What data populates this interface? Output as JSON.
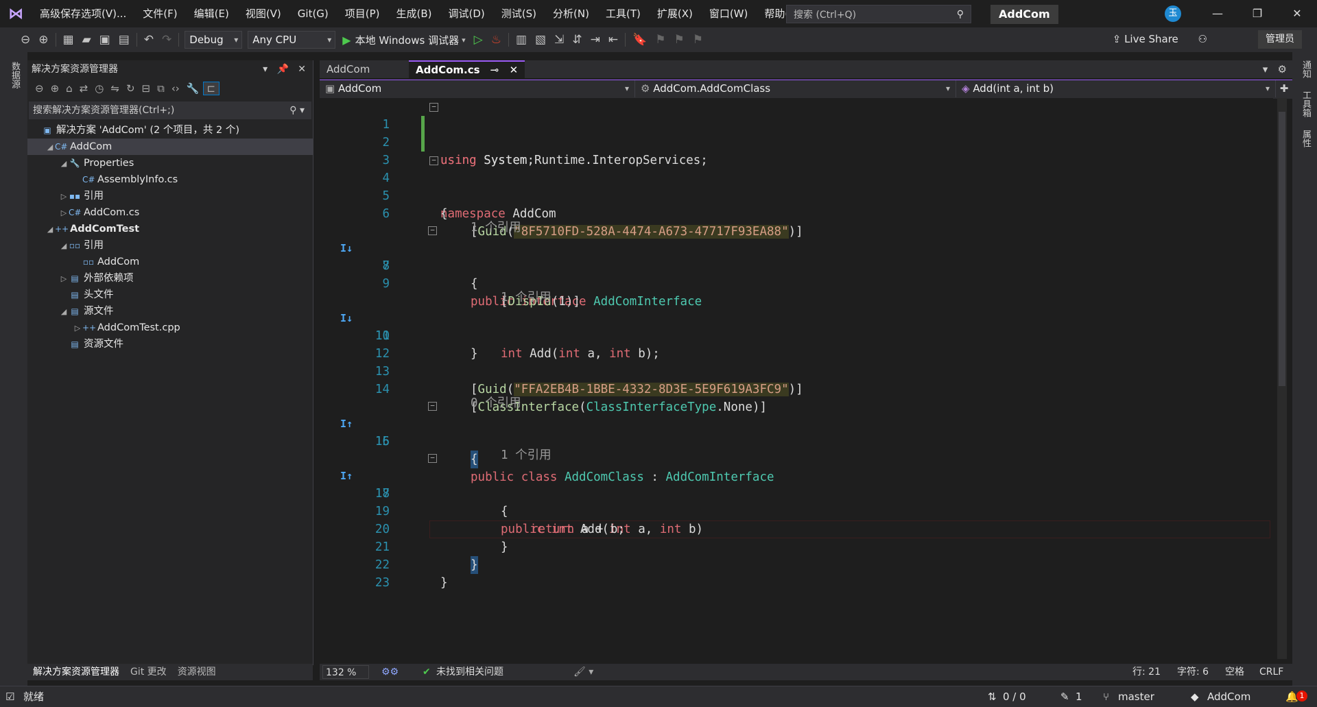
{
  "menu": [
    "高级保存选项(V)...",
    "文件(F)",
    "编辑(E)",
    "视图(V)",
    "Git(G)",
    "项目(P)",
    "生成(B)",
    "调试(D)",
    "测试(S)",
    "分析(N)",
    "工具(T)",
    "扩展(X)",
    "窗口(W)",
    "帮助(H)"
  ],
  "search": {
    "placeholder": "搜索 (Ctrl+Q)"
  },
  "title": "AddCom",
  "avatar": "玉",
  "toolbar": {
    "config": "Debug",
    "platform": "Any CPU",
    "run_label": "本地 Windows 调试器",
    "live_share": "Live Share",
    "admin": "管理员"
  },
  "left_strip": "数据源",
  "right_strip": [
    "通知",
    "工具箱",
    "属性"
  ],
  "solution_explorer": {
    "title": "解决方案资源管理器",
    "search_placeholder": "搜索解决方案资源管理器(Ctrl+;)",
    "tree": [
      {
        "label": "解决方案 'AddCom' (2 个项目，共 2 个)",
        "indent": 0,
        "arrow": "",
        "icon": "▣",
        "bold": false,
        "selected": false
      },
      {
        "label": "AddCom",
        "indent": 1,
        "arrow": "◢",
        "icon": "C#",
        "bold": false,
        "selected": true
      },
      {
        "label": "Properties",
        "indent": 2,
        "arrow": "◢",
        "icon": "🔧",
        "bold": false,
        "selected": false
      },
      {
        "label": "AssemblyInfo.cs",
        "indent": 3,
        "arrow": "",
        "icon": "C#",
        "bold": false,
        "selected": false
      },
      {
        "label": "引用",
        "indent": 2,
        "arrow": "▷",
        "icon": "▪▪",
        "bold": false,
        "selected": false
      },
      {
        "label": "AddCom.cs",
        "indent": 2,
        "arrow": "▷",
        "icon": "C#",
        "bold": false,
        "selected": false
      },
      {
        "label": "AddComTest",
        "indent": 1,
        "arrow": "◢",
        "icon": "++",
        "bold": true,
        "selected": false
      },
      {
        "label": "引用",
        "indent": 2,
        "arrow": "◢",
        "icon": "▫▫",
        "bold": false,
        "selected": false
      },
      {
        "label": "AddCom",
        "indent": 3,
        "arrow": "",
        "icon": "▫▫",
        "bold": false,
        "selected": false
      },
      {
        "label": "外部依赖项",
        "indent": 2,
        "arrow": "▷",
        "icon": "▤",
        "bold": false,
        "selected": false
      },
      {
        "label": "头文件",
        "indent": 2,
        "arrow": "",
        "icon": "▤",
        "bold": false,
        "selected": false
      },
      {
        "label": "源文件",
        "indent": 2,
        "arrow": "◢",
        "icon": "▤",
        "bold": false,
        "selected": false
      },
      {
        "label": "AddComTest.cpp",
        "indent": 3,
        "arrow": "▷",
        "icon": "++",
        "bold": false,
        "selected": false
      },
      {
        "label": "资源文件",
        "indent": 2,
        "arrow": "",
        "icon": "▤",
        "bold": false,
        "selected": false
      }
    ],
    "bottom_tabs": [
      "解决方案资源管理器",
      "Git 更改",
      "资源视图"
    ]
  },
  "editor": {
    "tabs": [
      {
        "label": "AddCom",
        "active": false
      },
      {
        "label": "AddCom.cs",
        "active": true
      }
    ],
    "nav": [
      "AddCom",
      "AddCom.AddComClass",
      "Add(int a, int b)"
    ],
    "lens": {
      "l6": "1 个引用",
      "l9": "1 个引用",
      "l14": "0 个引用",
      "l16": "1 个引用"
    },
    "lines": [
      "1",
      "2",
      "3",
      "4",
      "5",
      "6",
      "7",
      "8",
      "9",
      "10",
      "11",
      "12",
      "13",
      "14",
      "15",
      "16",
      "17",
      "18",
      "19",
      "20",
      "21",
      "22",
      "23"
    ],
    "code": {
      "l1_kw": "using",
      "l1_rest": " System;",
      "l2_kw": "using",
      "l2_rest": " System.Runtime.InteropServices;",
      "l4_kw": "namespace",
      "l4_rest": " AddCom",
      "l5": "{",
      "l6_a": "[",
      "l6_attr": "Guid",
      "l6_b": "(",
      "l6_str": "\"8F5710FD-528A-4474-A673-47717F93EA88\"",
      "l6_c": ")]",
      "l7_kw": "public interface",
      "l7_ty": "AddComInterface",
      "l8": "{",
      "l9_a": "[",
      "l9_attr": "DispId",
      "l9_b": "(",
      "l9_num": "1",
      "l9_c": ")]",
      "l10_kw": "int",
      "l10_name": " Add(",
      "l10_t1": "int",
      "l10_p1": " a, ",
      "l10_t2": "int",
      "l10_p2": " b);",
      "l11": "}",
      "l13_a": "[",
      "l13_attr": "Guid",
      "l13_b": "(",
      "l13_str": "\"FFA2EB4B-1BBE-4332-8D3E-5E9F619A3FC9\"",
      "l13_c": ")]",
      "l14_a": "[",
      "l14_attr": "ClassInterface",
      "l14_b": "(",
      "l14_ty": "ClassInterfaceType",
      "l14_c": ".None)]",
      "l15_kw": "public class",
      "l15_ty": "AddComClass",
      "l15_sep": " : ",
      "l15_ty2": "AddComInterface",
      "l16": "{",
      "l17_kw": "public int",
      "l17_name": " Add(",
      "l17_t1": "int",
      "l17_p1": " a, ",
      "l17_t2": "int",
      "l17_p2": " b)",
      "l18": "{",
      "l19_kw": "return",
      "l19_rest": " a + b;",
      "l20": "}",
      "l21": "}",
      "l22": "}"
    }
  },
  "editor_status": {
    "zoom": "132 %",
    "issues": "未找到相关问题",
    "line": "行: 21",
    "char": "字符: 6",
    "space": "空格",
    "eol": "CRLF"
  },
  "status": {
    "ready": "就绪",
    "updown": "0 / 0",
    "pencil": "1",
    "branch": "master",
    "repo": "AddCom",
    "bell_count": "1"
  }
}
